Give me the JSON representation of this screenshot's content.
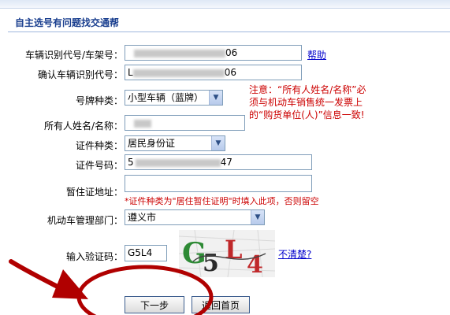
{
  "header": {
    "title": "自主选号有问题找交通帮"
  },
  "form": {
    "vin": {
      "label": "车辆识别代号/车架号：",
      "suffix": "06"
    },
    "vin_confirm": {
      "label": "确认车辆识别代号：",
      "prefix": "L",
      "suffix": "06"
    },
    "help_link": "帮助",
    "plate_type": {
      "label": "号牌种类：",
      "selected": "小型车辆（蓝牌）"
    },
    "owner_name": {
      "label": "所有人姓名/名称："
    },
    "id_type": {
      "label": "证件种类：",
      "selected": "居民身份证"
    },
    "id_number": {
      "label": "证件号码：",
      "prefix": "5",
      "suffix": "47"
    },
    "temp_address": {
      "label": "暂住证地址：",
      "value": ""
    },
    "temp_hint": "*证件种类为\"居住暂住证明\"时填入此项，否则留空",
    "vehicle_office": {
      "label": "机动车管理部门：",
      "selected": "遵义市"
    },
    "captcha_input": {
      "label": "输入验证码：",
      "value": "G5L4"
    },
    "captcha_image": {
      "chars": [
        "G",
        "5",
        "L",
        "4"
      ]
    },
    "unclear_link": "不清楚?"
  },
  "notice": "注意：“所有人姓名/名称”必须与机动车销售统一发票上的“购货单位(人)”信息一致!",
  "buttons": {
    "next": "下一步",
    "back_home": "返回首页"
  },
  "colors": {
    "title": "#1a3f8f",
    "notice": "#cc0000",
    "annotation": "#b00000",
    "link": "#0000cc"
  }
}
